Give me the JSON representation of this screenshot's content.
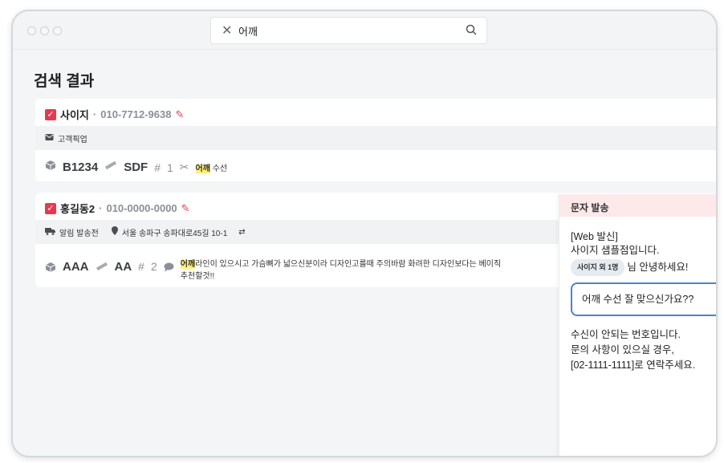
{
  "search": {
    "value": "어깨"
  },
  "page": {
    "title": "검색 결과"
  },
  "results": [
    {
      "name": "사이지",
      "phone": "010-7712-9638",
      "strip_text": "고객픽업",
      "code": "B1234",
      "ruler_value": "SDF",
      "count": "1",
      "keyword": "어깨",
      "memo_rest": "수선"
    },
    {
      "name": "홍길동2",
      "phone": "010-0000-0000",
      "alert_status": "알림 발송전",
      "address": "서울 송파구 송파대로45길 10-1",
      "code": "AAA",
      "ruler_value": "AA",
      "count": "2",
      "keyword": "어깨",
      "memo_rest": "라인이 있으시고 가슴뼈가 넓으신분이라 디자인고를때 주의바람 화려한 디자인보다는 베이직",
      "memo_line2": "추천할것!!"
    }
  ],
  "sms_panel": {
    "title": "문자 발송",
    "line1": "[Web 발신]",
    "line2": "사이지 샘플점입니다.",
    "chip": "사이지 외 1명",
    "greeting": "님 안녕하세요!",
    "message": "어깨 수선 잘 맞으신가요??",
    "tail1": "수신이 안되는 번호입니다.",
    "tail2": "문의 사항이 있으실 경우,",
    "tail3": "[02-1111-1111]로 연락주세요."
  },
  "colors": {
    "accent": "#e53950",
    "highlight": "#fff17a",
    "focus": "#4d7fd8"
  }
}
